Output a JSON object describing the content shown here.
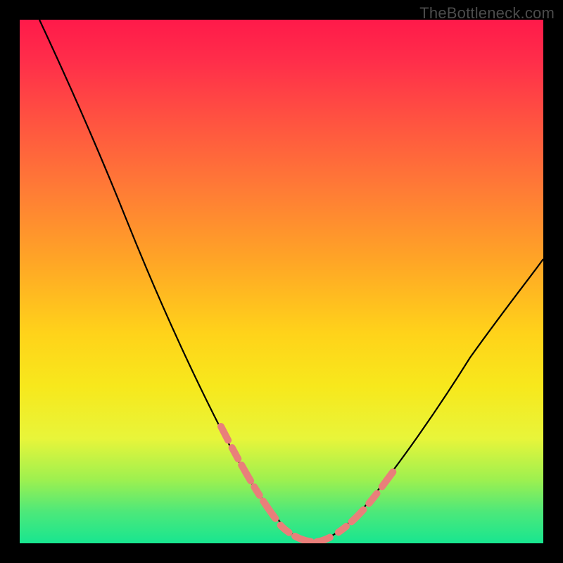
{
  "watermark": "TheBottleneck.com",
  "colors": {
    "page_bg": "#000000",
    "curve": "#000000",
    "dash": "#e97f7a",
    "gradient_top": "#ff1a4a",
    "gradient_bottom": "#18e690"
  },
  "chart_data": {
    "type": "line",
    "title": "",
    "xlabel": "",
    "ylabel": "",
    "xlim": [
      0,
      100
    ],
    "ylim": [
      0,
      100
    ],
    "grid": false,
    "legend": false,
    "annotations": [
      "TheBottleneck.com"
    ],
    "series": [
      {
        "name": "left-curve",
        "x": [
          3.8,
          8,
          12,
          16,
          20,
          24,
          28,
          32,
          36,
          40,
          43,
          46,
          49,
          52,
          55
        ],
        "y": [
          100,
          90,
          80,
          70,
          60,
          50,
          41,
          33,
          25,
          18,
          12,
          7,
          3.5,
          1.5,
          0.5
        ]
      },
      {
        "name": "right-curve",
        "x": [
          56,
          60,
          64,
          68,
          72,
          76,
          80,
          84,
          88,
          92,
          96,
          100
        ],
        "y": [
          0.5,
          2,
          5,
          9,
          14,
          20,
          26,
          32,
          38,
          44,
          49,
          54
        ]
      },
      {
        "name": "left-dash-band",
        "x": [
          38,
          40,
          42,
          44,
          46,
          48,
          50,
          52,
          54,
          56
        ],
        "y": [
          22,
          18,
          14.5,
          11,
          8,
          5.5,
          3.5,
          2,
          1,
          0.5
        ]
      },
      {
        "name": "right-dash-band",
        "x": [
          57,
          60,
          63,
          66,
          69,
          72,
          75
        ],
        "y": [
          0.5,
          2,
          4.5,
          8,
          12,
          16,
          20
        ]
      }
    ]
  }
}
